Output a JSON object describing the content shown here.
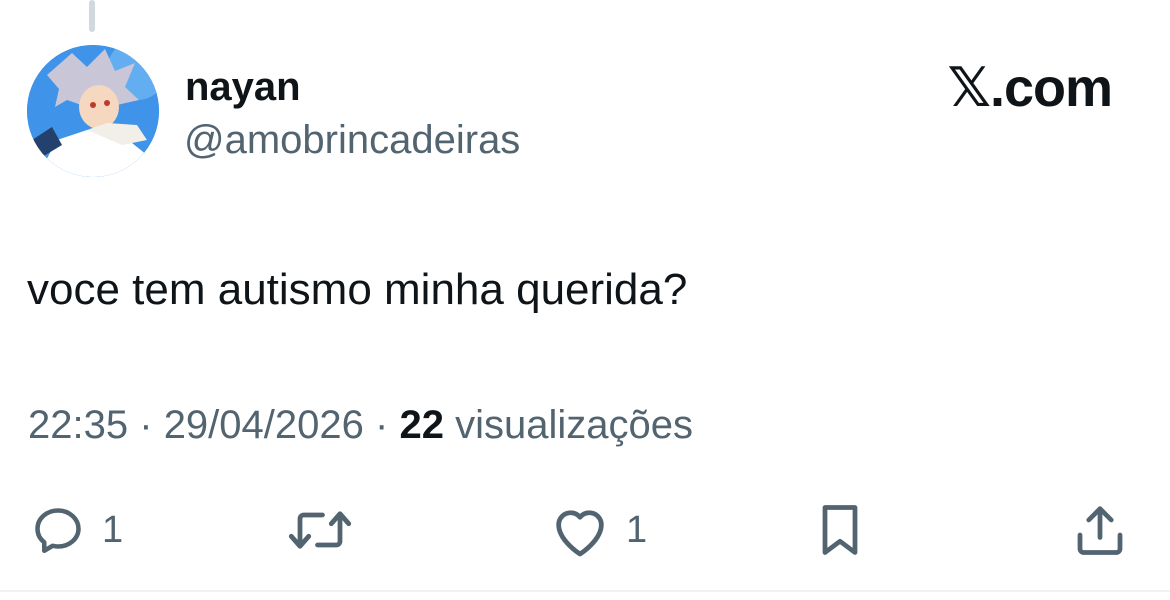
{
  "header": {
    "display_name": "nayan",
    "handle": "@amobrincadeiras",
    "brand_mark": "𝕏",
    "brand_suffix": ".com"
  },
  "tweet": {
    "text": "voce tem autismo minha querida?",
    "time": "22:35",
    "date": "29/04/2026",
    "views_count": "22",
    "views_label": "visualizações",
    "separator": "·"
  },
  "actions": {
    "reply": {
      "icon": "reply-icon",
      "count": "1"
    },
    "retweet": {
      "icon": "retweet-icon",
      "count": ""
    },
    "like": {
      "icon": "heart-icon",
      "count": "1"
    },
    "bookmark": {
      "icon": "bookmark-icon",
      "count": ""
    },
    "share": {
      "icon": "share-icon",
      "count": ""
    }
  },
  "colors": {
    "text_primary": "#0f1419",
    "text_secondary": "#536471",
    "avatar_bg": "#3f93e8"
  }
}
